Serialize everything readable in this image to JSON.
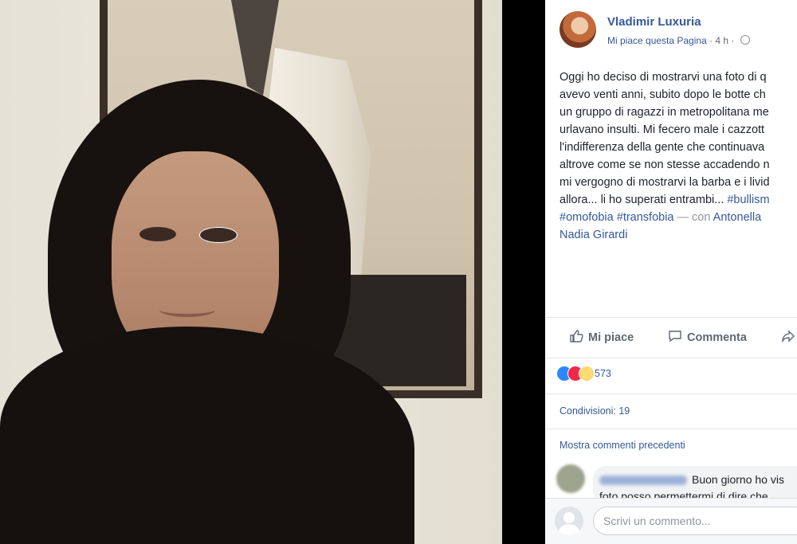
{
  "post": {
    "author": "Vladimir Luxuria",
    "follow_link": "Mi piace questa Pagina",
    "separator": " · ",
    "time": "4 h",
    "time_sep": " · ",
    "text_lines": [
      "Oggi ho deciso di mostrarvi una foto di q",
      "avevo venti anni, subito dopo le botte ch",
      "un gruppo di ragazzi in metropolitana me",
      "urlavano insulti. Mi fecero male i cazzott",
      "l'indifferenza della gente che continuava",
      "altrove come se non stesse accadendo n",
      "mi vergogno di mostrarvi la barba e i livid",
      "allora... li ho superati entrambi... "
    ],
    "hashtag_bullismo": "#bullism",
    "hashtag_omofobia": "#omofobia",
    "space": " ",
    "hashtag_transfobia": "#transfobia",
    "with_prefix": " — con ",
    "tagged_1": "Antonella",
    "tagged_2": "Nadia Girardi"
  },
  "actions": {
    "like": "Mi piace",
    "comment": "Commenta"
  },
  "stats": {
    "reactions_count": "573",
    "shares": "Condivisioni: 19"
  },
  "comments": {
    "more": "Mostra commenti precedenti",
    "first_text_line1": "Buon giorno ho vis",
    "first_text_line2": "foto posso permettermi di dire che"
  },
  "composer": {
    "placeholder": "Scrivi un commento..."
  },
  "colors": {
    "link": "#365899",
    "text": "#1d2129",
    "meta": "#616770"
  }
}
